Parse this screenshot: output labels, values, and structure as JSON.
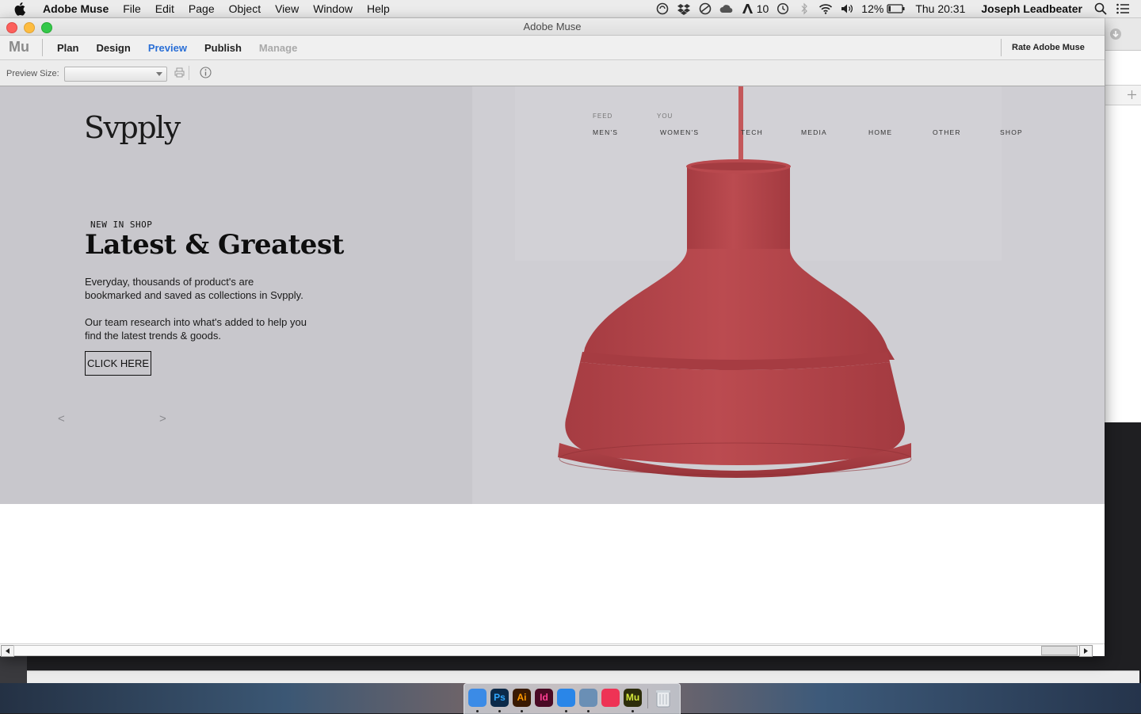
{
  "menubar": {
    "app_name": "Adobe Muse",
    "menus": [
      "File",
      "Edit",
      "Page",
      "Object",
      "View",
      "Window",
      "Help"
    ],
    "status": {
      "badge_count": "10",
      "battery": "12%",
      "clock": "Thu 20:31",
      "user": "Joseph Leadbeater"
    }
  },
  "window": {
    "title": "Adobe Muse",
    "logo": "Mu",
    "tabs": [
      {
        "label": "Plan",
        "state": "normal"
      },
      {
        "label": "Design",
        "state": "normal"
      },
      {
        "label": "Preview",
        "state": "active"
      },
      {
        "label": "Publish",
        "state": "normal"
      },
      {
        "label": "Manage",
        "state": "disabled"
      }
    ],
    "rate_label": "Rate Adobe Muse",
    "preview_size_label": "Preview Size:",
    "preview_size_value": ""
  },
  "site": {
    "logo": "Svpply",
    "nav_top": [
      "FEED",
      "YOU"
    ],
    "nav": [
      "MEN'S",
      "WOMEN'S",
      "TECH",
      "MEDIA",
      "HOME",
      "OTHER",
      "SHOP"
    ],
    "kicker": "NEW IN SHOP",
    "headline": "Latest & Greatest",
    "paragraph1": [
      "Everyday, thousands of product's are",
      "bookmarked and saved as collections in Svpply."
    ],
    "paragraph2": [
      "Our team research into what's added to help you",
      "find the latest trends & goods."
    ],
    "cta": "CLICK HERE",
    "prev_arrow": "<",
    "next_arrow": ">"
  },
  "dock": {
    "apps": [
      {
        "name": "Finder",
        "glyph": "",
        "color": "#3b8be6",
        "running": true
      },
      {
        "name": "Photoshop",
        "glyph": "Ps",
        "color": "#0b2a4a",
        "running": true
      },
      {
        "name": "Illustrator",
        "glyph": "Ai",
        "color": "#3a1a02",
        "running": true
      },
      {
        "name": "InDesign",
        "glyph": "Id",
        "color": "#4a0a24",
        "running": false
      },
      {
        "name": "Safari",
        "glyph": "",
        "color": "#2a86e8",
        "running": true
      },
      {
        "name": "Preview",
        "glyph": "",
        "color": "#6a8fb5",
        "running": true
      },
      {
        "name": "iTunes",
        "glyph": "",
        "color": "#ee3355",
        "running": false
      },
      {
        "name": "Muse",
        "glyph": "Mu",
        "color": "#2d2d0b",
        "running": true
      }
    ]
  },
  "colors": {
    "lamp": "#b8474c",
    "accent": "#2a6fd6",
    "hero_bg": "#c8c7cc"
  }
}
